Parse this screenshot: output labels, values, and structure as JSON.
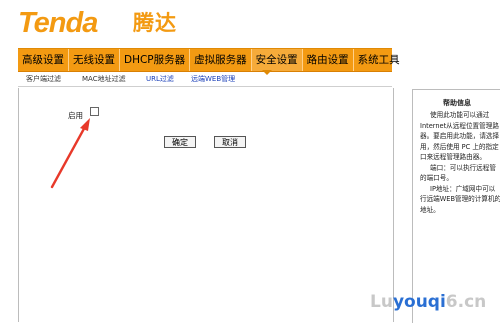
{
  "logo": {
    "brand_en": "Tenda",
    "brand_cn": "腾达"
  },
  "nav": {
    "items": [
      "高级设置",
      "无线设置",
      "DHCP服务器",
      "虚拟服务器",
      "安全设置",
      "路由设置",
      "系统工具"
    ],
    "active_index": 4
  },
  "subnav": {
    "items": [
      "客户端过滤",
      "MAC地址过滤",
      "URL过滤",
      "远端WEB管理"
    ]
  },
  "form": {
    "enable_label": "启用",
    "enable_checked": false,
    "ok_label": "确定",
    "cancel_label": "取消"
  },
  "help": {
    "title": "帮助信息",
    "lines": [
      "使用此功能可以通过",
      "Internet从远程位置管理路",
      "器。要启用此功能，请选择",
      "用，然后使用 PC 上的指定",
      "口来远程管理路由器。",
      "端口：可以执行远程管",
      "的端口号。",
      "IP地址：广域网中可以",
      "行远端WEB管理的计算机的",
      "地址。"
    ]
  },
  "watermark": {
    "part1": "Lu",
    "part2": "youqi",
    "part3": "6.cn"
  },
  "colors": {
    "accent": "#f39a12",
    "link": "#1a3fb8",
    "arrow": "#e8392a"
  }
}
